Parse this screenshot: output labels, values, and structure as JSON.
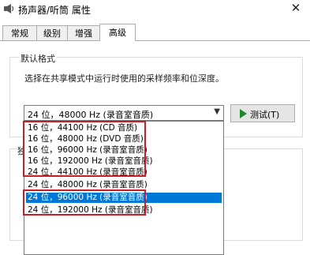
{
  "window": {
    "title": "扬声器/听筒 属性",
    "close_glyph": "✕"
  },
  "tabs": [
    {
      "label": "常规"
    },
    {
      "label": "级别"
    },
    {
      "label": "增强"
    },
    {
      "label": "高级",
      "active": true
    }
  ],
  "default_format": {
    "group_title": "默认格式",
    "description": "选择在共享模式中运行时使用的采样频率和位深度。",
    "selected": "24 位，48000 Hz (录音室音质)",
    "test_button": "测试(T)",
    "test_icon": "play-icon"
  },
  "second_group_title_partial": "独",
  "dropdown_options": [
    {
      "label": "16 位，44100 Hz (CD 音质)"
    },
    {
      "label": "16 位，48000 Hz (DVD 音质)"
    },
    {
      "label": "16 位，96000 Hz (录音室音质)"
    },
    {
      "label": "16 位，192000 Hz (录音室音质)"
    },
    {
      "label": "24 位，44100 Hz (录音室音质)"
    },
    {
      "label": "24 位，48000 Hz (录音室音质)"
    },
    {
      "label": "24 位，96000 Hz (录音室音质)",
      "highlighted": true
    },
    {
      "label": "24 位，192000 Hz (录音室音质)"
    }
  ],
  "colors": {
    "highlight": "#0078d7",
    "annotation_red": "#cc1d27",
    "play_green": "#1e8a2c"
  }
}
